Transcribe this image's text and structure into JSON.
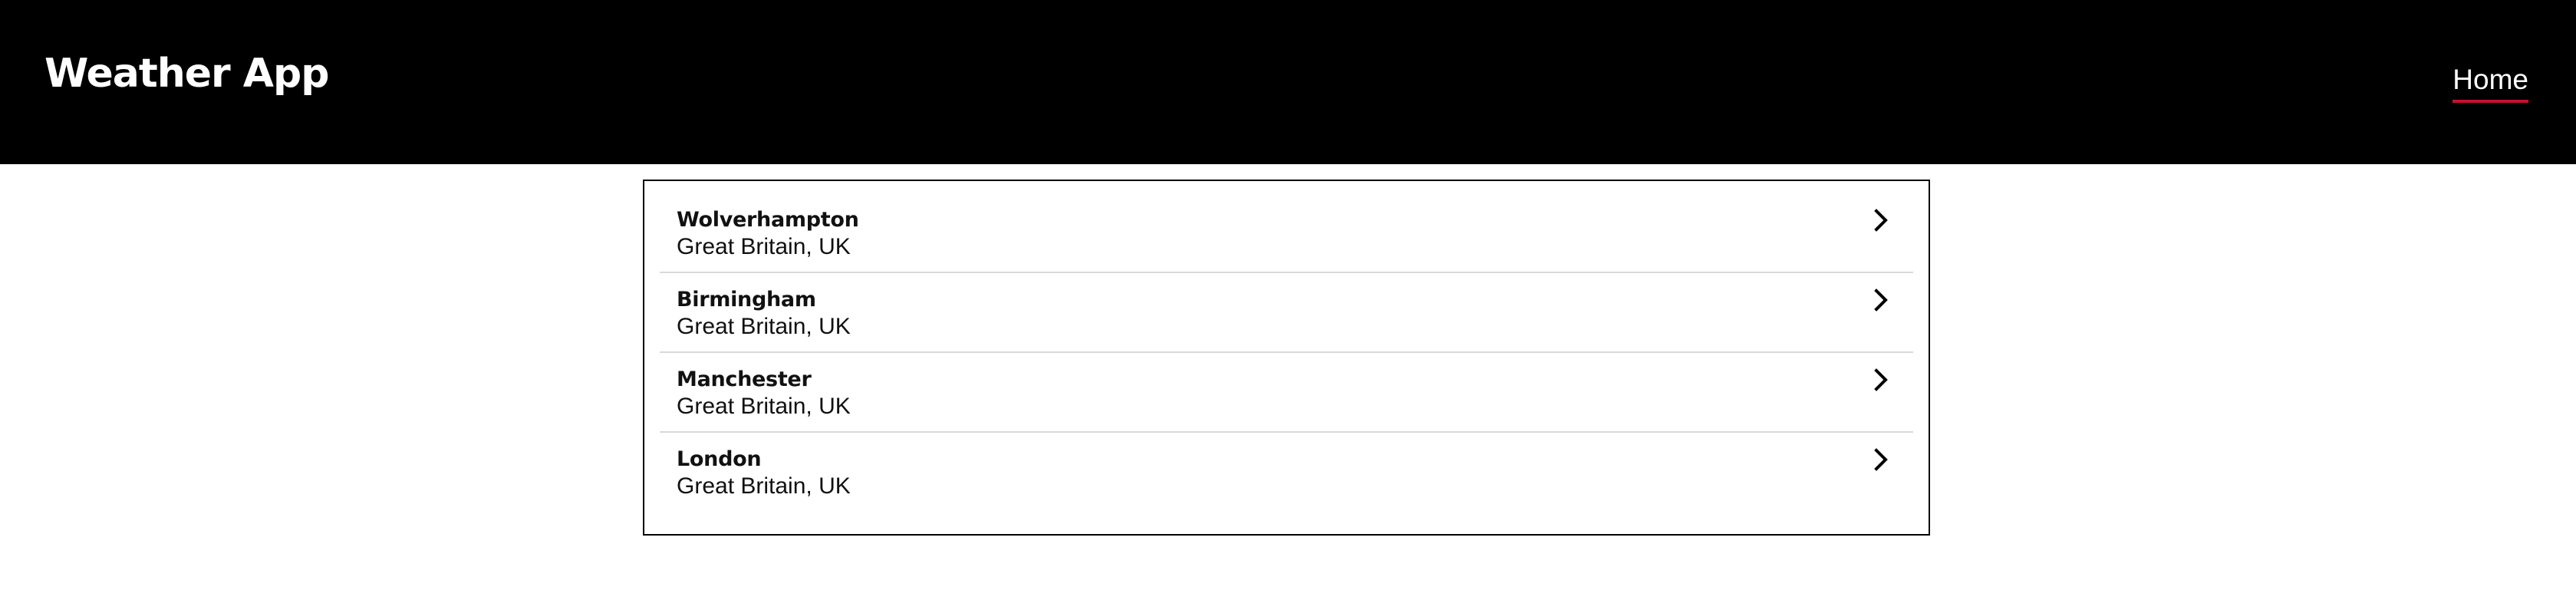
{
  "header": {
    "title": "Weather App",
    "nav": {
      "home_label": "Home"
    }
  },
  "cities": [
    {
      "name": "Wolverhampton",
      "region": "Great Britain, UK"
    },
    {
      "name": "Birmingham",
      "region": "Great Britain, UK"
    },
    {
      "name": "Manchester",
      "region": "Great Britain, UK"
    },
    {
      "name": "London",
      "region": "Great Britain, UK"
    }
  ],
  "icons": {
    "row_chevron": "chevron-right-icon"
  },
  "colors": {
    "header_background": "#000000",
    "header_text": "#ffffff",
    "nav_underline": "#c8102e",
    "divider": "#d9d9d9",
    "card_border": "#000000"
  }
}
